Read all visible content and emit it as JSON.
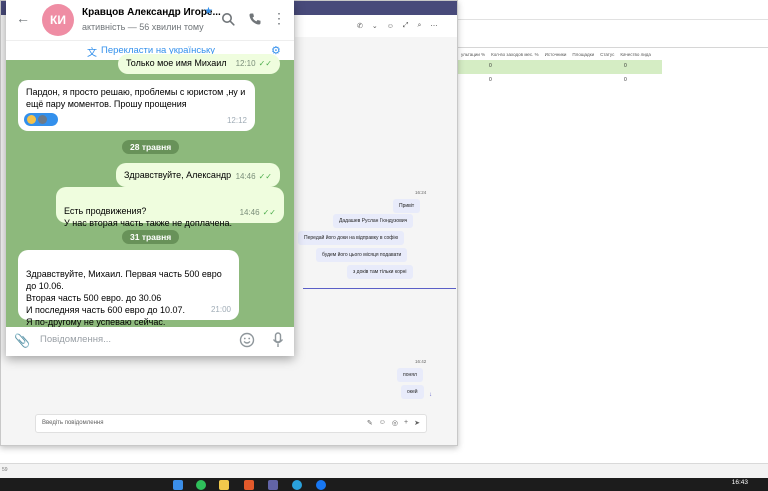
{
  "telegram": {
    "contact_name": "Кравцов Александр Игоре...",
    "avatar_initials": "КИ",
    "status": "активність — 56 хвилин тому",
    "translate_link": "Перекласти на українську",
    "input_placeholder": "Повідомлення...",
    "messages": [
      {
        "text": "Только мое имя Михаил",
        "time": "12:10",
        "dir": "out"
      },
      {
        "text": "Пардон, я просто решаю, проблемы с юристом ,ну и ещё пару моментов. Прошу прощения",
        "time": "12:12",
        "dir": "in"
      },
      {
        "text": "Здравствуйте, Александр",
        "time": "14:46",
        "dir": "out"
      },
      {
        "text": "Есть продвижения?\nУ нас вторая часть также не доплачена.",
        "time": "14:46",
        "dir": "out"
      },
      {
        "text": "Здравствуйте, Михаил. Первая часть 500 евро до 10.06.\nВторая часть 500 евро. до 30.06\nИ последняя часть 600 евро до 10.07.\nЯ по-другому не успеваю сейчас.",
        "time": "21:00",
        "dir": "in"
      }
    ],
    "date_separators": [
      "28 травня",
      "31 травня"
    ]
  },
  "teams": {
    "compose_placeholder": "Введіть повідомлення",
    "timestamps": [
      "16:24",
      "16:42"
    ],
    "messages": [
      "Привіт",
      "Дадашев Руслан Гюндузович",
      "Передай його доки на відправку в софію",
      "будем його цього місяця подавати",
      "з доків там тільки корні",
      "понял",
      "окей"
    ]
  },
  "spreadsheet": {
    "headers": [
      "ультации %",
      "Кол-во заходов мес. %",
      "Источники",
      "Площадки",
      "Статус",
      "Качество лида"
    ],
    "rows": [
      [
        "0",
        "0"
      ],
      [
        "0",
        "0"
      ]
    ],
    "status_text": "59"
  },
  "taskbar": {
    "clock": "16:43",
    "date": ""
  },
  "colors": {
    "telegram_accent": "#3390ec",
    "teams_accent": "#5b5fc7",
    "outgoing_bubble": "#effdde",
    "chat_background": "#8db97c"
  }
}
